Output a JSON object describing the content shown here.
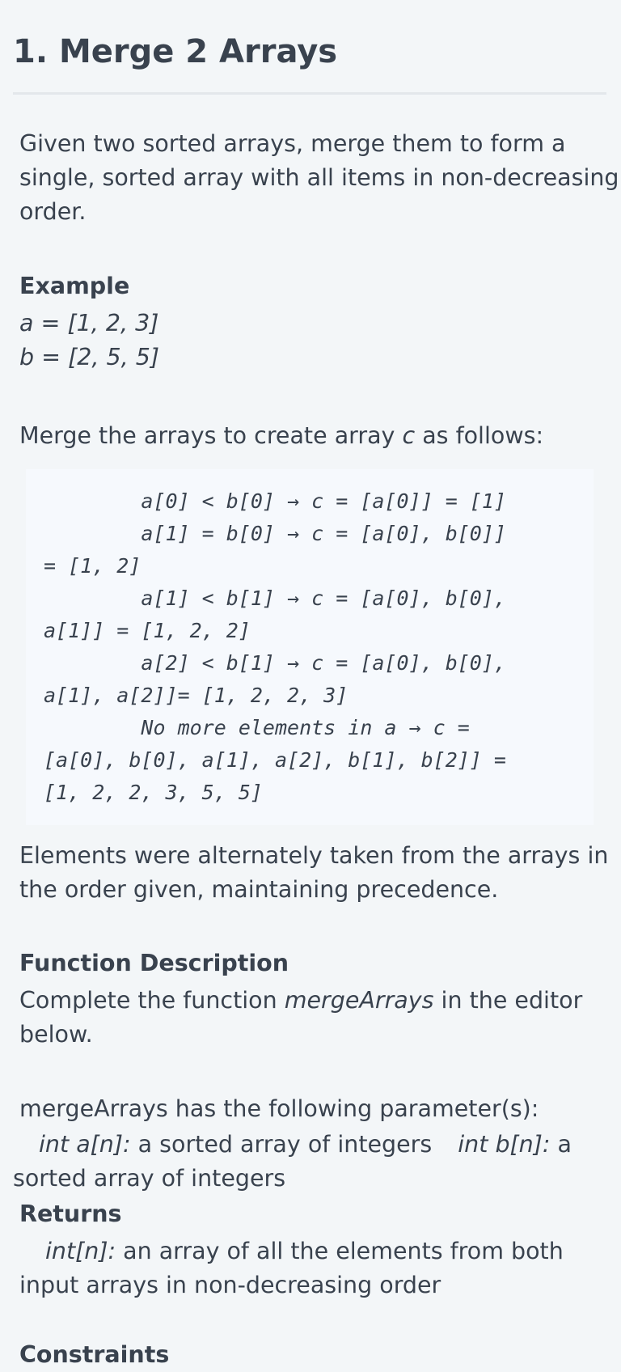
{
  "problem": {
    "title": "1. Merge 2 Arrays",
    "statement": [
      "Given two sorted arrays, merge them to form a",
      "single, sorted array with all items in non-decreasing",
      "order."
    ]
  },
  "example": {
    "heading": "Example",
    "a_line": "a = [1, 2, 3]",
    "b_line": "b = [2, 5, 5]",
    "intro_before": "Merge the arrays to create array ",
    "intro_var": "c",
    "intro_after": " as follows:",
    "code_lines": [
      "        a[0] < b[0] → c = [a[0]] = [1]",
      "        a[1] = b[0] → c = [a[0], b[0]]",
      "= [1, 2]",
      "        a[1] < b[1] → c = [a[0], b[0],",
      "a[1]] = [1, 2, 2]",
      "        a[2] < b[1] → c = [a[0], b[0],",
      "a[1], a[2]]= [1, 2, 2, 3]",
      "        No more elements in a → c =",
      "[a[0], b[0], a[1], a[2], b[1], b[2]] =",
      "[1, 2, 2, 3, 5, 5]"
    ],
    "conclusion": [
      "Elements were alternately taken from the arrays in",
      "the order given, maintaining precedence."
    ]
  },
  "function_description": {
    "heading": "Function Description",
    "line1_before": "Complete the function ",
    "line1_fn": "mergeArrays",
    "line1_after": " in the editor",
    "line2": "below."
  },
  "parameters": {
    "intro": "mergeArrays has the following parameter(s):",
    "p1_name": "int a[n]:",
    "p1_desc": " a sorted array of integers",
    "p2_name": "int b[n]:",
    "p2_desc_part1": " a",
    "p2_desc_part2": "sorted array of integers"
  },
  "returns": {
    "heading": "Returns",
    "name": "int[n]:",
    "desc_part1": " an array of all the elements from both",
    "desc_part2": "input arrays in non-decreasing order"
  },
  "next_section": {
    "heading": "Constraints"
  }
}
